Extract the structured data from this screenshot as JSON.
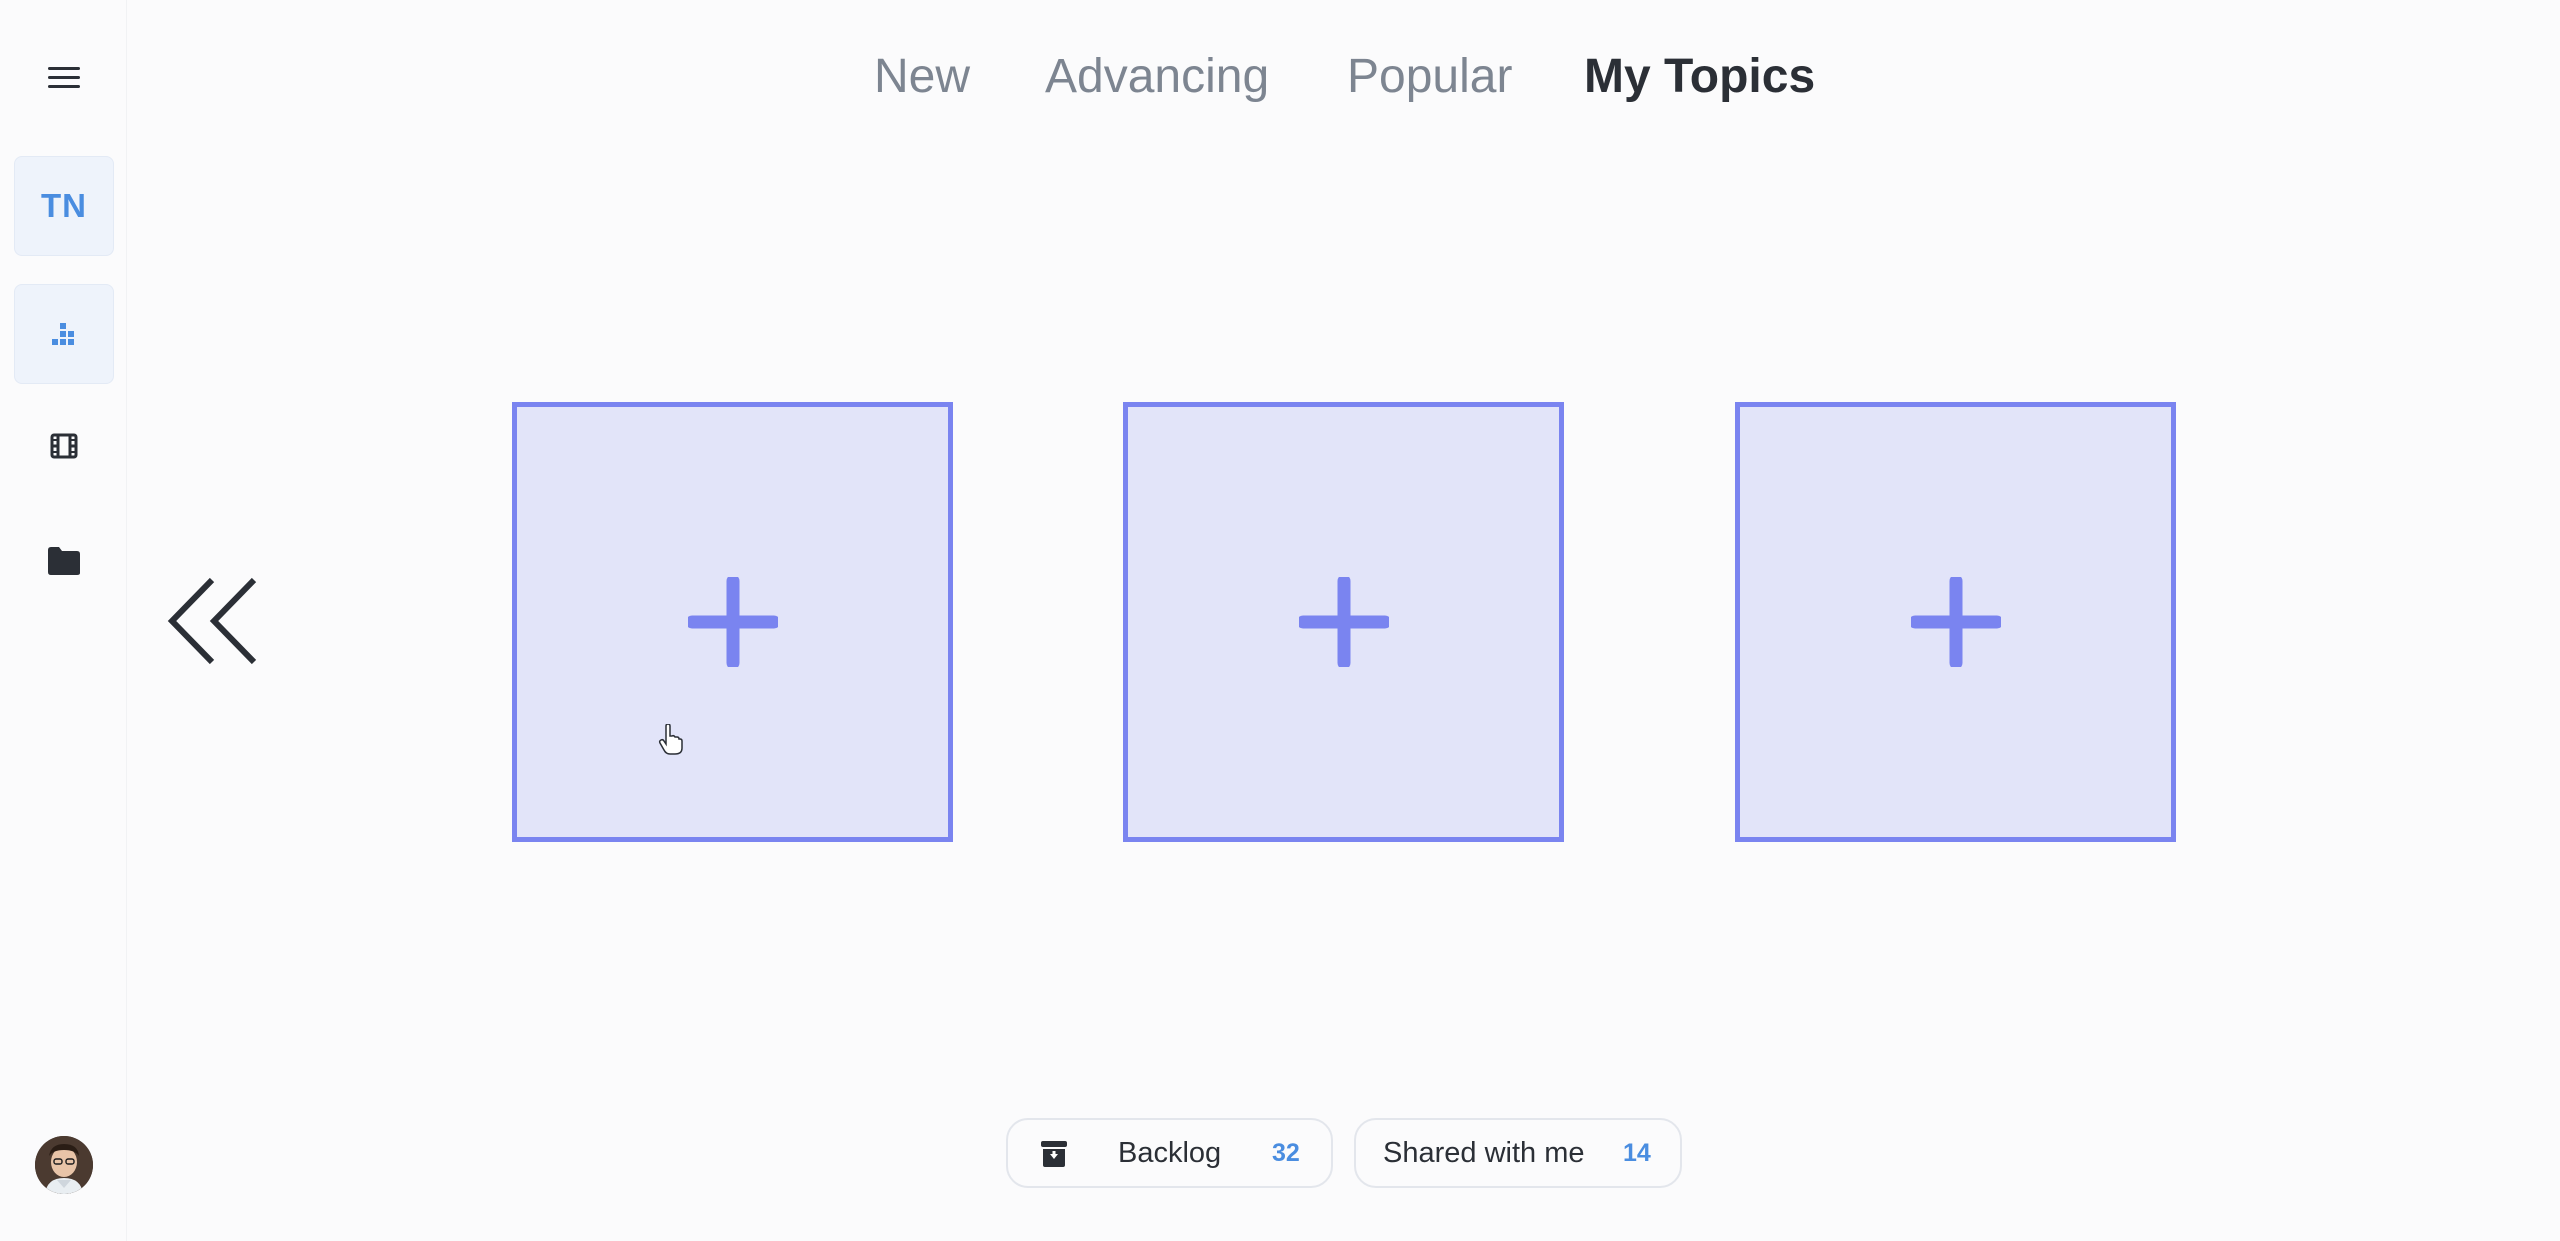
{
  "sidebar": {
    "menu_icon": "hamburger-menu-icon",
    "workspace_initials": "TN",
    "items": [
      {
        "icon": "dashboard-blocks-icon",
        "active": true
      },
      {
        "icon": "film-icon",
        "active": false
      },
      {
        "icon": "folder-icon",
        "active": false
      }
    ],
    "avatar_icon": "user-avatar"
  },
  "tabs": [
    {
      "label": "New",
      "active": false
    },
    {
      "label": "Advancing",
      "active": false
    },
    {
      "label": "Popular",
      "active": false
    },
    {
      "label": "My Topics",
      "active": true
    }
  ],
  "main": {
    "back_icon": "double-chevron-left-icon",
    "add_cards": [
      {
        "icon": "plus-icon"
      },
      {
        "icon": "plus-icon"
      },
      {
        "icon": "plus-icon"
      }
    ]
  },
  "footer": {
    "backlog": {
      "icon": "archive-box-icon",
      "label": "Backlog",
      "count": "32"
    },
    "shared": {
      "label": "Shared with me",
      "count": "14"
    }
  },
  "colors": {
    "accent_blue": "#4a8de0",
    "card_border": "#7a84f0",
    "card_fill": "#e2e4f9",
    "text_dark": "#2b2f36",
    "text_muted": "#7d8591"
  }
}
